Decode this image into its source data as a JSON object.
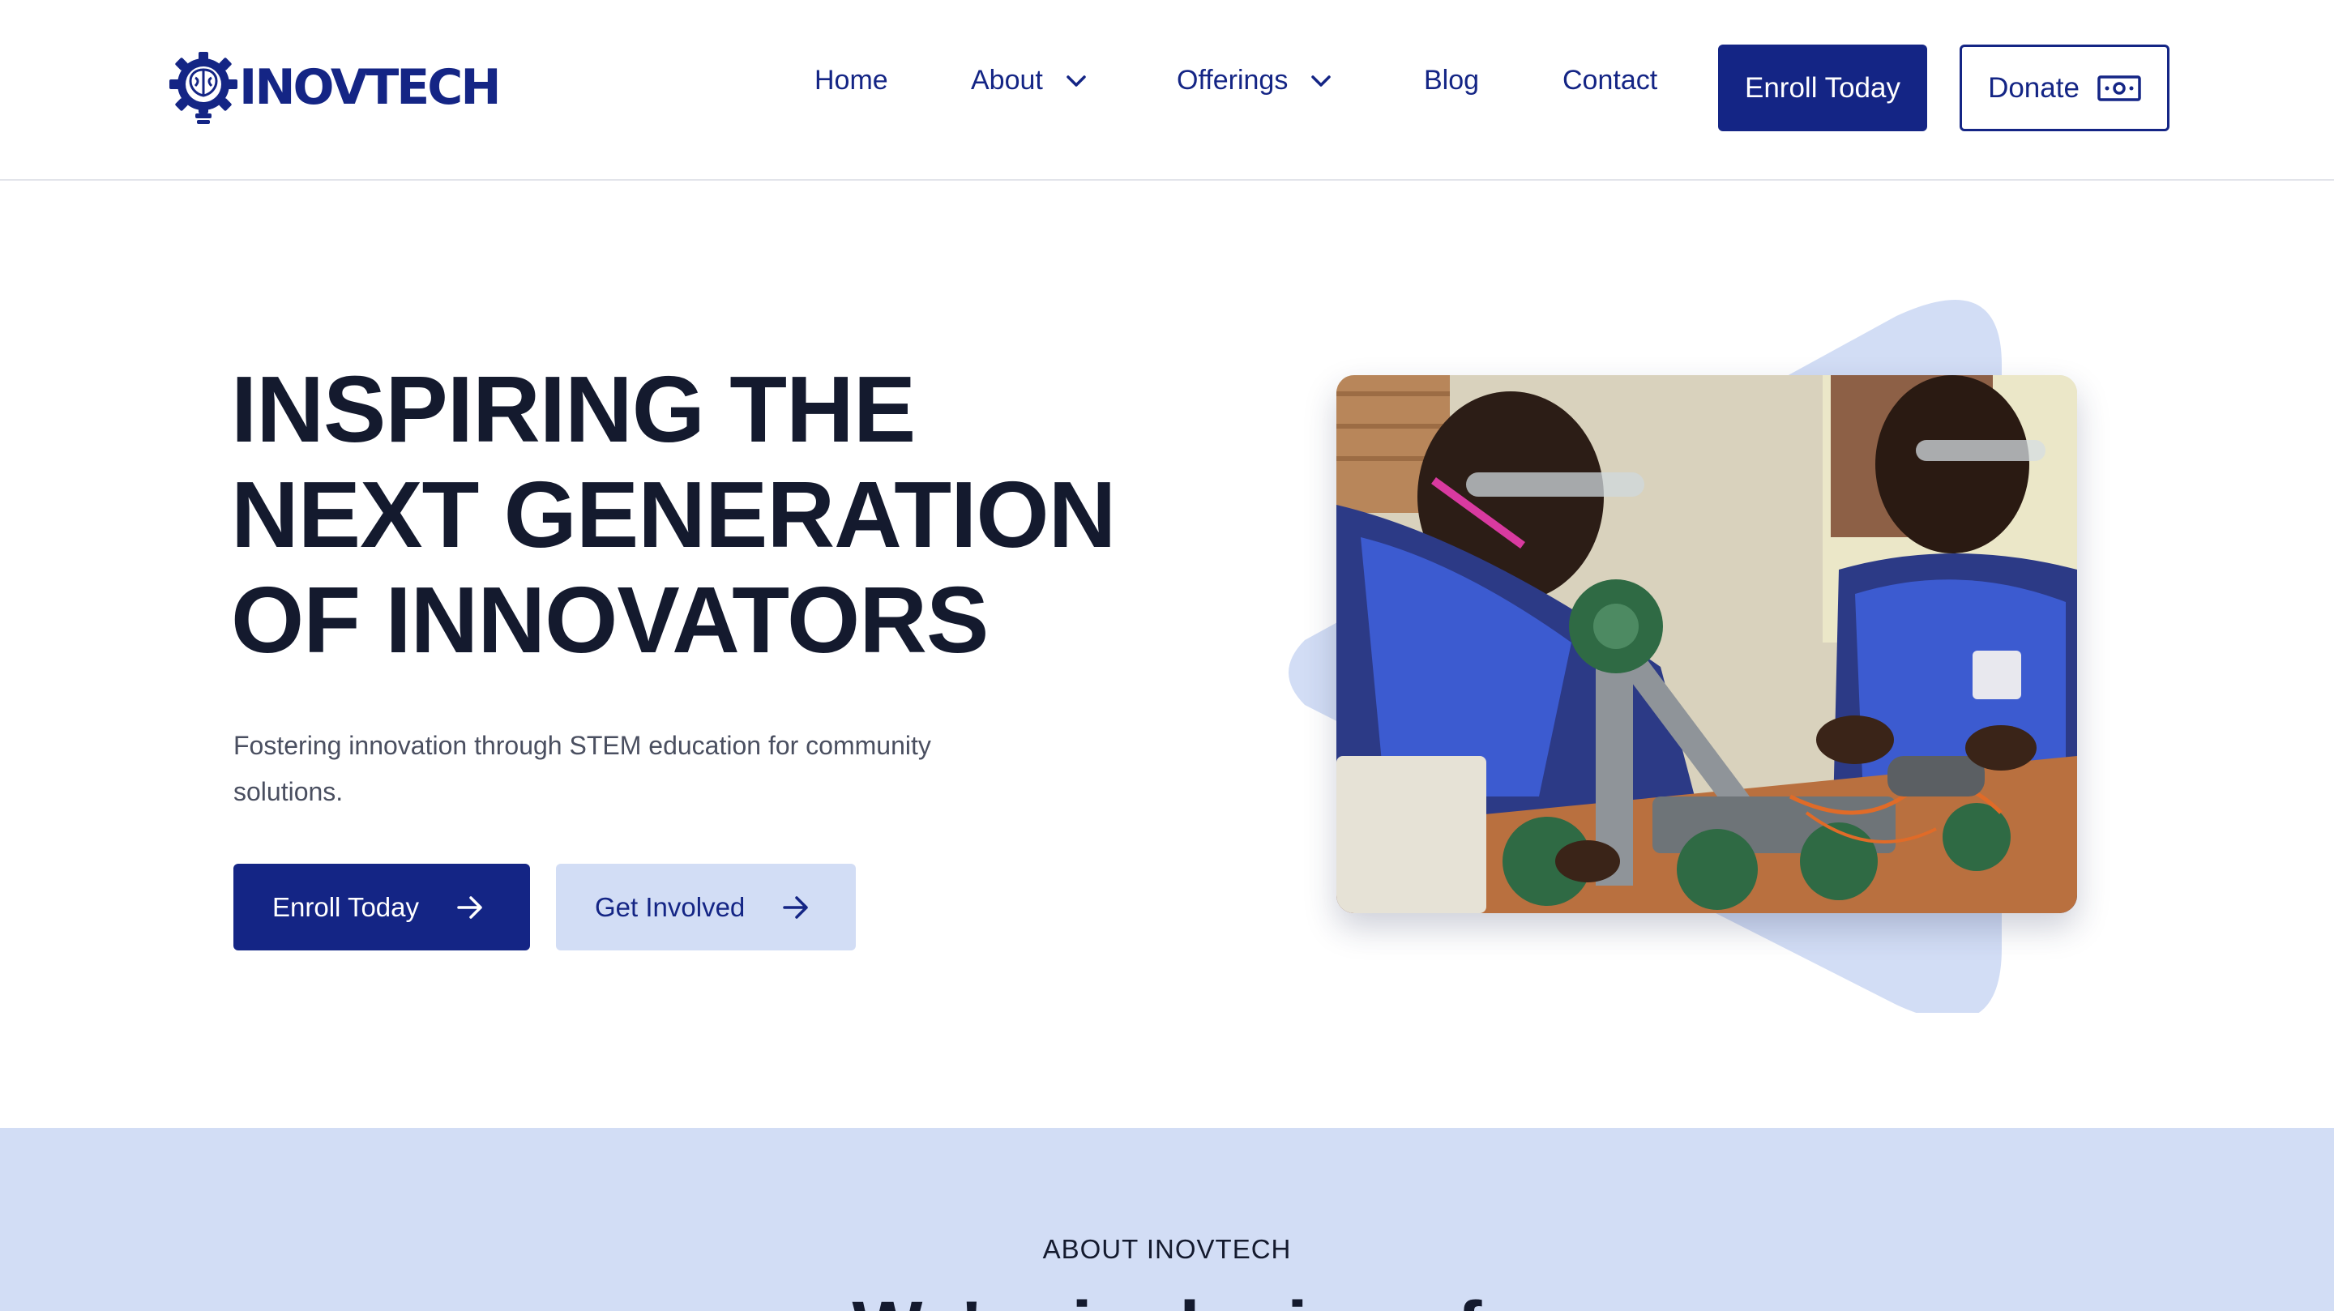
{
  "brand": {
    "logo_text": "INOVTECH",
    "primary_color": "#142585",
    "light_color": "#d2ddf5"
  },
  "nav": {
    "home": "Home",
    "about": "About",
    "offerings": "Offerings",
    "blog": "Blog",
    "contact": "Contact",
    "enroll_label": "Enroll Today",
    "donate_label": "Donate"
  },
  "hero": {
    "title_lines": [
      "INSPIRING THE",
      "NEXT GENERATION",
      "OF INNOVATORS"
    ],
    "subtitle": "Fostering innovation through STEM education for community solutions.",
    "primary_cta": "Enroll Today",
    "secondary_cta": "Get Involved"
  },
  "about": {
    "label": "ABOUT INOVTECH",
    "heading": "We're inclusive of"
  },
  "icons": {
    "logo": "gear-brain-icon",
    "chevron": "chevron-down-icon",
    "donate": "money-icon",
    "arrow": "arrow-right-icon"
  }
}
